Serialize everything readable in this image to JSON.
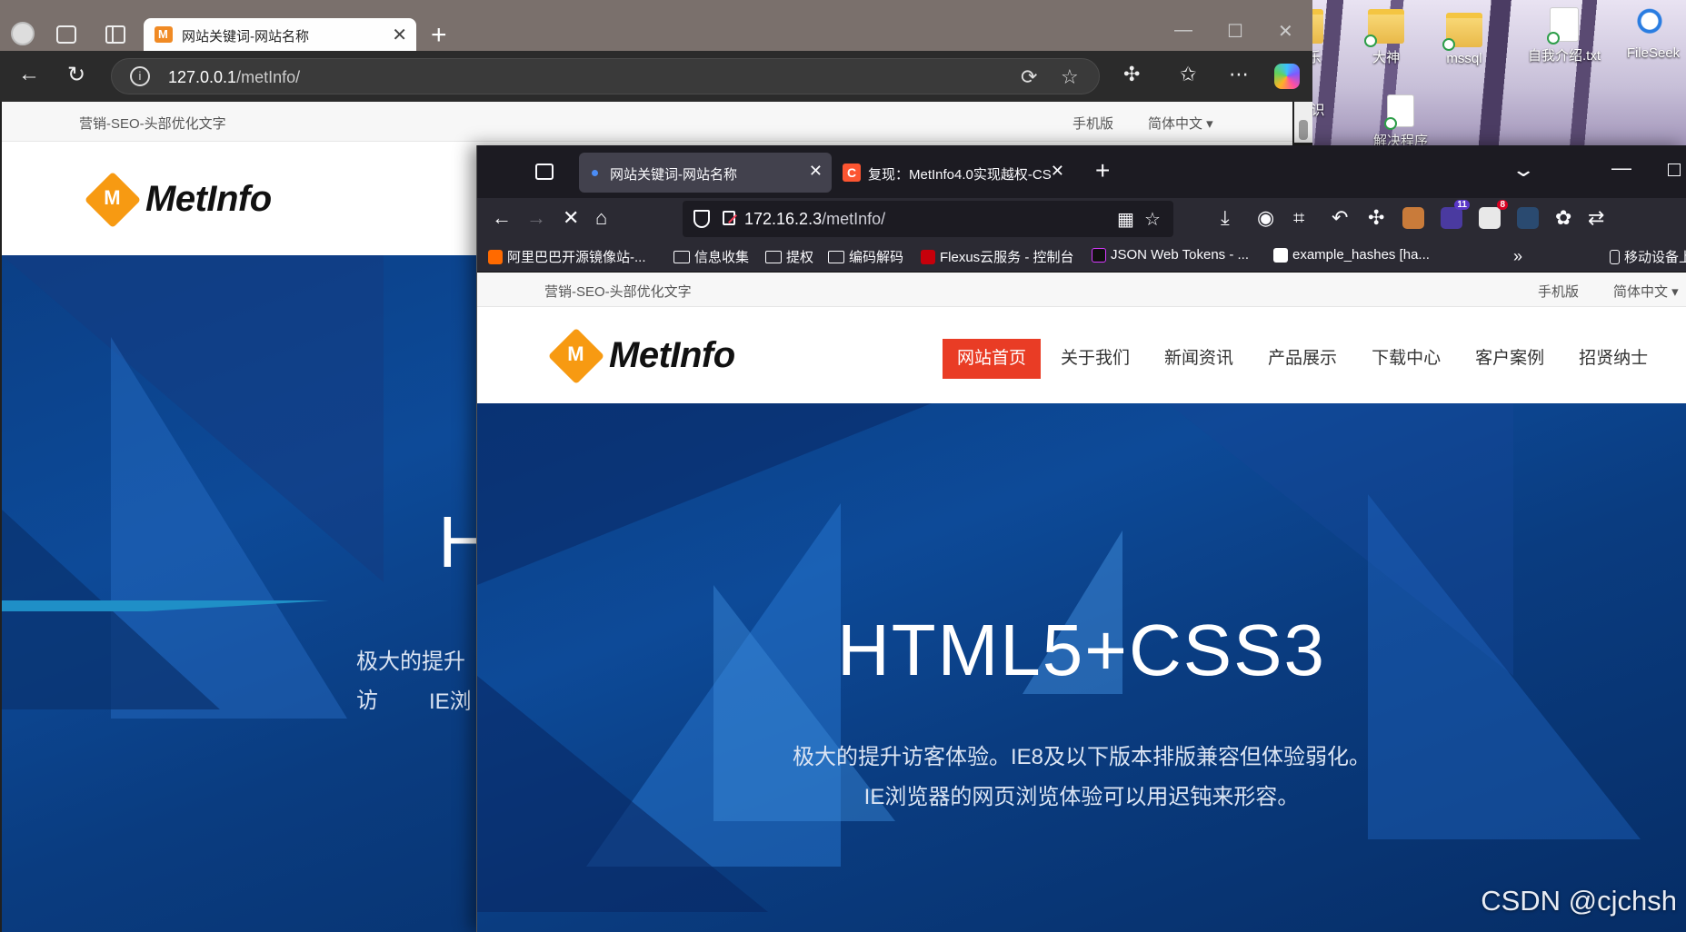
{
  "desktop": {
    "icons": [
      {
        "label": "乐",
        "type": "folder"
      },
      {
        "label": "大神",
        "type": "folder"
      },
      {
        "label": "mssql",
        "type": "folder"
      },
      {
        "label": "自我介绍.txt",
        "type": "file"
      },
      {
        "label": "FileSeek",
        "type": "app"
      },
      {
        "label": "识",
        "type": "folder"
      },
      {
        "label": "解决程序",
        "type": "file"
      }
    ],
    "watermark": "CSDN @cjchsh"
  },
  "edge": {
    "tab_title": "网站关键词-网站名称",
    "url_host": "127.0.0.1",
    "url_path": "/metInfo/",
    "site": {
      "top_slogan": "营销-SEO-头部优化文字",
      "mobile_link": "手机版",
      "language": "简体中文",
      "logo_text": "MetInfo",
      "hero_title_partial": "H",
      "hero_sub_line1_partial": "极大的提升访",
      "hero_sub_line2_partial": "IE浏"
    }
  },
  "firefox": {
    "tabs": [
      {
        "title": "网站关键词-网站名称",
        "active": true
      },
      {
        "title": "复现：MetInfo4.0实现越权-CS",
        "active": false
      }
    ],
    "url_host": "172.16.2.3",
    "url_path": "/metInfo/",
    "extension_badges": {
      "badge1": "11",
      "badge2": "8"
    },
    "bookmarks": [
      {
        "label": "阿里巴巴开源镜像站-...",
        "icon": "aliyun-icon"
      },
      {
        "label": "信息收集",
        "icon": "folder-icon"
      },
      {
        "label": "提权",
        "icon": "folder-icon"
      },
      {
        "label": "编码解码",
        "icon": "folder-icon"
      },
      {
        "label": "Flexus云服务 - 控制台",
        "icon": "huawei-icon"
      },
      {
        "label": "JSON Web Tokens - ...",
        "icon": "jwt-icon"
      },
      {
        "label": "example_hashes [ha...",
        "icon": "hashcat-icon"
      }
    ],
    "mobile_bookmarks": "移动设备上",
    "site": {
      "top_slogan": "营销-SEO-头部优化文字",
      "mobile_link": "手机版",
      "language": "简体中文",
      "logo_text": "MetInfo",
      "menu": [
        "网站首页",
        "关于我们",
        "新闻资讯",
        "产品展示",
        "下载中心",
        "客户案例",
        "招贤纳士"
      ],
      "hero_title": "HTML5+CSS3",
      "hero_sub_line1": "极大的提升访客体验。IE8及以下版本排版兼容但体验弱化。",
      "hero_sub_line2": "IE浏览器的网页浏览体验可以用迟钝来形容。"
    }
  },
  "colors": {
    "accent_red": "#e93c25",
    "logo_orange": "#f79a12",
    "hero_blue": "#0d4a98"
  }
}
